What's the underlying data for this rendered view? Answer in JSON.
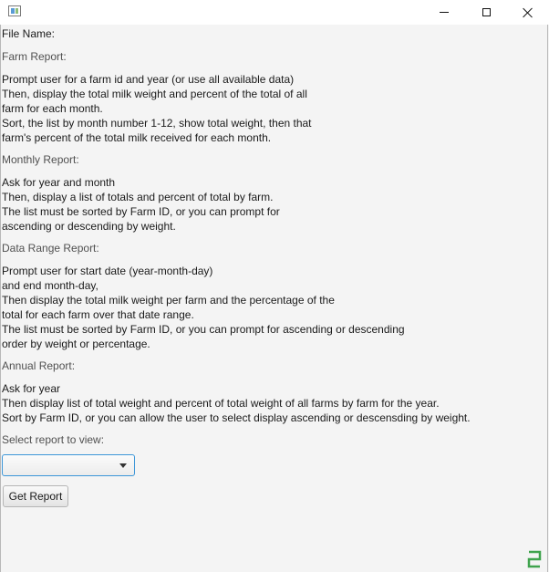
{
  "window": {
    "controls": {
      "minimize": "minimize",
      "maximize": "maximize",
      "close": "close"
    }
  },
  "content": {
    "file_name_label": "File Name:",
    "sections": [
      {
        "title": "Farm Report:",
        "lines": [
          "Prompt user for a farm id and year (or use all available data)",
          "Then, display the total milk weight and percent of the total of all",
          "farm for each month.",
          "Sort, the list by month number 1-12, show total weight, then that",
          "farm's percent of the total milk received for each month."
        ]
      },
      {
        "title": "Monthly Report:",
        "lines": [
          "Ask for year and month",
          "Then, display a list of totals and percent of total by farm.",
          "The list must be sorted by Farm ID, or you can prompt for",
          "ascending or descending by weight."
        ]
      },
      {
        "title": "Data Range Report:",
        "lines": [
          "Prompt user for start date (year-month-day)",
          "and end month-day,",
          "Then display the total milk weight per farm and the percentage of the",
          "total for each farm over that date range.",
          "The list must be sorted by Farm ID, or you can prompt for ascending or descending",
          "order by weight or percentage."
        ]
      },
      {
        "title": "Annual Report:",
        "lines": [
          "Ask for year",
          "Then display list of total weight and percent of total weight of all farms by farm for the year.",
          "Sort by Farm ID, or you can allow the user to select display ascending or descensding by weight."
        ]
      }
    ],
    "select_label": "Select report to view:",
    "report_select": {
      "value": ""
    },
    "get_report_button": "Get Report"
  },
  "colors": {
    "focus_border": "#3c96d8",
    "corner_mark": "#3fa34d"
  }
}
